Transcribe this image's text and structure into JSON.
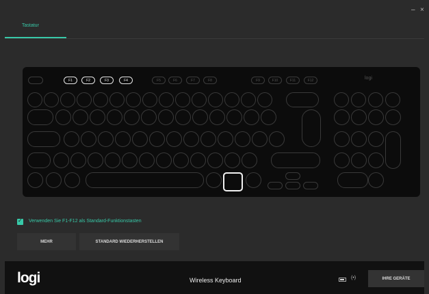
{
  "window": {
    "minimize_glyph": "–",
    "close_glyph": "×"
  },
  "tabs": [
    {
      "label": "Tastatur",
      "active": true
    }
  ],
  "keyboard": {
    "brand": "logi",
    "fkeys_active": [
      "F1",
      "F2",
      "F3",
      "F4"
    ],
    "fkeys_dim": [
      "F5",
      "F6",
      "F7",
      "F8",
      "F9",
      "F10",
      "F11",
      "F12"
    ]
  },
  "options": {
    "checkbox_label": "Verwenden Sie F1-F12 als Standard-Funktionstasten",
    "checked": true
  },
  "buttons": {
    "more": "MEHR",
    "restore": "STANDARD WIEDERHERSTELLEN"
  },
  "footer": {
    "logo": "logi",
    "device_name": "Wireless Keyboard",
    "connection_glyph": "(•)",
    "devices_button": "IHRE GERÄTE"
  },
  "colors": {
    "accent": "#38c9a8",
    "background": "#2b2b2b",
    "footer": "#111111"
  }
}
